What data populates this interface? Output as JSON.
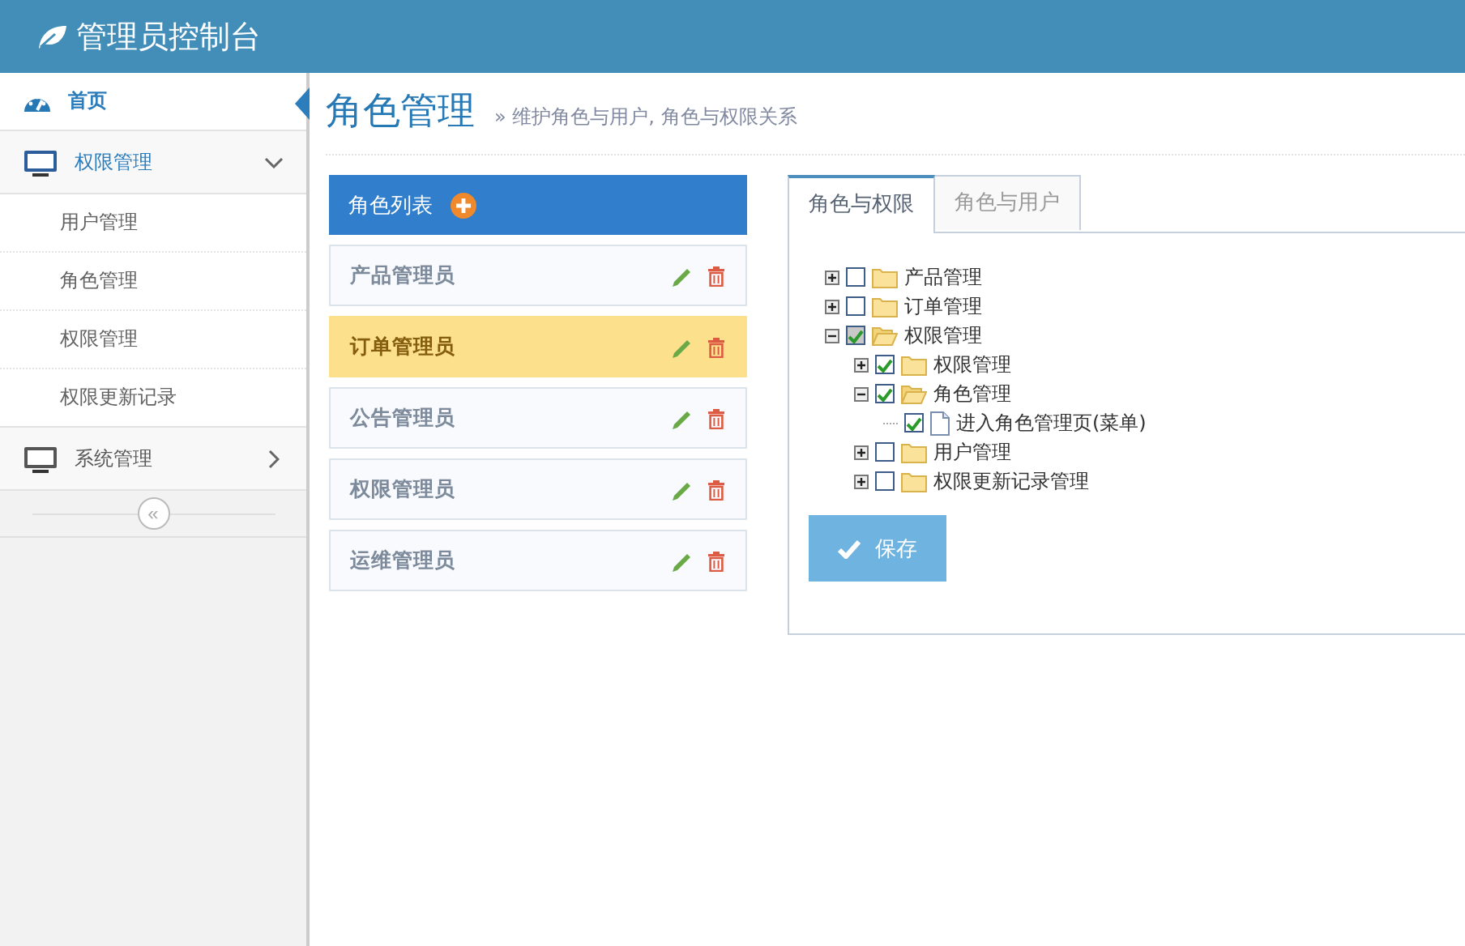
{
  "header": {
    "title": "管理员控制台"
  },
  "sidebar": {
    "items": [
      {
        "label": "首页",
        "kind": "home",
        "selected": true
      },
      {
        "label": "权限管理",
        "kind": "group",
        "expanded": true,
        "children": [
          {
            "label": "用户管理",
            "selected": false
          },
          {
            "label": "角色管理",
            "selected": false
          },
          {
            "label": "权限管理",
            "selected": false
          },
          {
            "label": "权限更新记录",
            "selected": false
          }
        ]
      },
      {
        "label": "系统管理",
        "kind": "group",
        "expanded": false
      }
    ],
    "collapse_button": "«"
  },
  "page": {
    "title": "角色管理",
    "subtitle": "» 维护角色与用户, 角色与权限关系"
  },
  "role_list": {
    "title": "角色列表",
    "roles": [
      {
        "name": "产品管理员",
        "selected": false
      },
      {
        "name": "订单管理员",
        "selected": true
      },
      {
        "name": "公告管理员",
        "selected": false
      },
      {
        "name": "权限管理员",
        "selected": false
      },
      {
        "name": "运维管理员",
        "selected": false
      }
    ]
  },
  "tabs": [
    {
      "label": "角色与权限",
      "selected": true
    },
    {
      "label": "角色与用户",
      "selected": false
    }
  ],
  "tree": [
    {
      "label": "产品管理",
      "kind": "folder",
      "expanded": false,
      "checked": false,
      "partial": false
    },
    {
      "label": "订单管理",
      "kind": "folder",
      "expanded": false,
      "checked": false,
      "partial": false
    },
    {
      "label": "权限管理",
      "kind": "folder",
      "expanded": true,
      "checked": true,
      "partial": true,
      "children": [
        {
          "label": "权限管理",
          "kind": "folder",
          "expanded": false,
          "checked": true,
          "partial": false
        },
        {
          "label": "角色管理",
          "kind": "folder",
          "expanded": true,
          "checked": true,
          "partial": false,
          "children": [
            {
              "label": "进入角色管理页(菜单)",
              "kind": "leaf",
              "checked": true,
              "partial": false
            }
          ]
        },
        {
          "label": "用户管理",
          "kind": "folder",
          "expanded": false,
          "checked": false,
          "partial": false
        },
        {
          "label": "权限更新记录管理",
          "kind": "folder",
          "expanded": false,
          "checked": false,
          "partial": false
        }
      ]
    }
  ],
  "save_button": "保存"
}
